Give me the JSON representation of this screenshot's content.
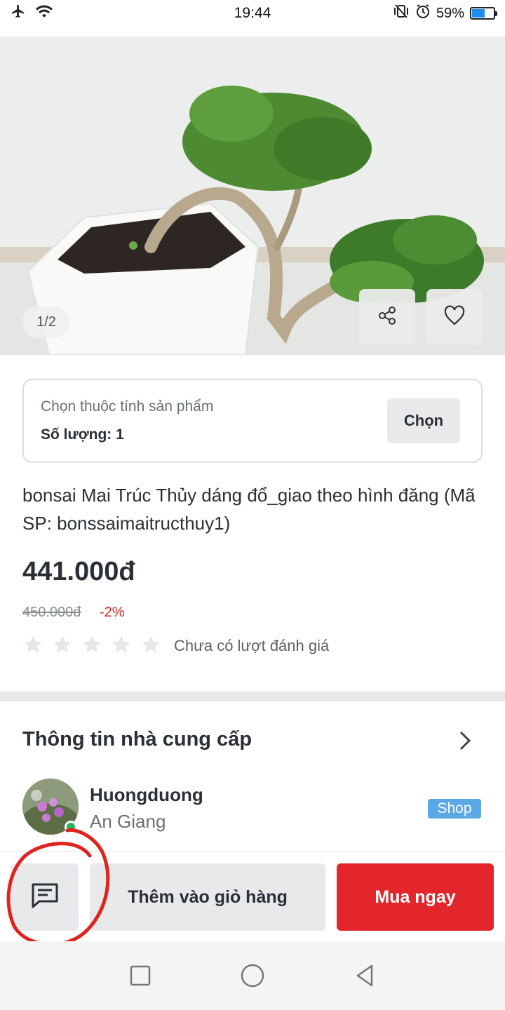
{
  "status_bar": {
    "time": "19:44",
    "battery_text": "59%",
    "battery_level": 0.59,
    "icons": [
      "airplane-icon",
      "wifi-icon",
      "vibrate-icon",
      "alarm-icon",
      "battery-icon"
    ]
  },
  "gallery": {
    "counter": "1/2"
  },
  "variant": {
    "label": "Chọn thuộc tính sản phẩm",
    "quantity": "Số lượng: 1",
    "choose_label": "Chọn"
  },
  "product": {
    "title": "bonsai Mai Trúc Thủy dáng đổ_giao theo hình đăng (Mã SP: bonssaimaitructhuy1)",
    "price": "441.000đ",
    "old_price": "450.000đ",
    "discount": "-2%",
    "rating_stars": 0,
    "rating_text": "Chưa có lượt đánh giá"
  },
  "supplier": {
    "section_title": "Thông tin nhà cung cấp",
    "name": "Huongduong",
    "location": "An Giang",
    "badge": "Shop"
  },
  "actions": {
    "add_to_cart": "Thêm vào giỏ hàng",
    "buy_now": "Mua ngay"
  },
  "colors": {
    "accent_red": "#e3262b",
    "shop_badge": "#5aa8e6",
    "annotation": "#e0231f"
  }
}
